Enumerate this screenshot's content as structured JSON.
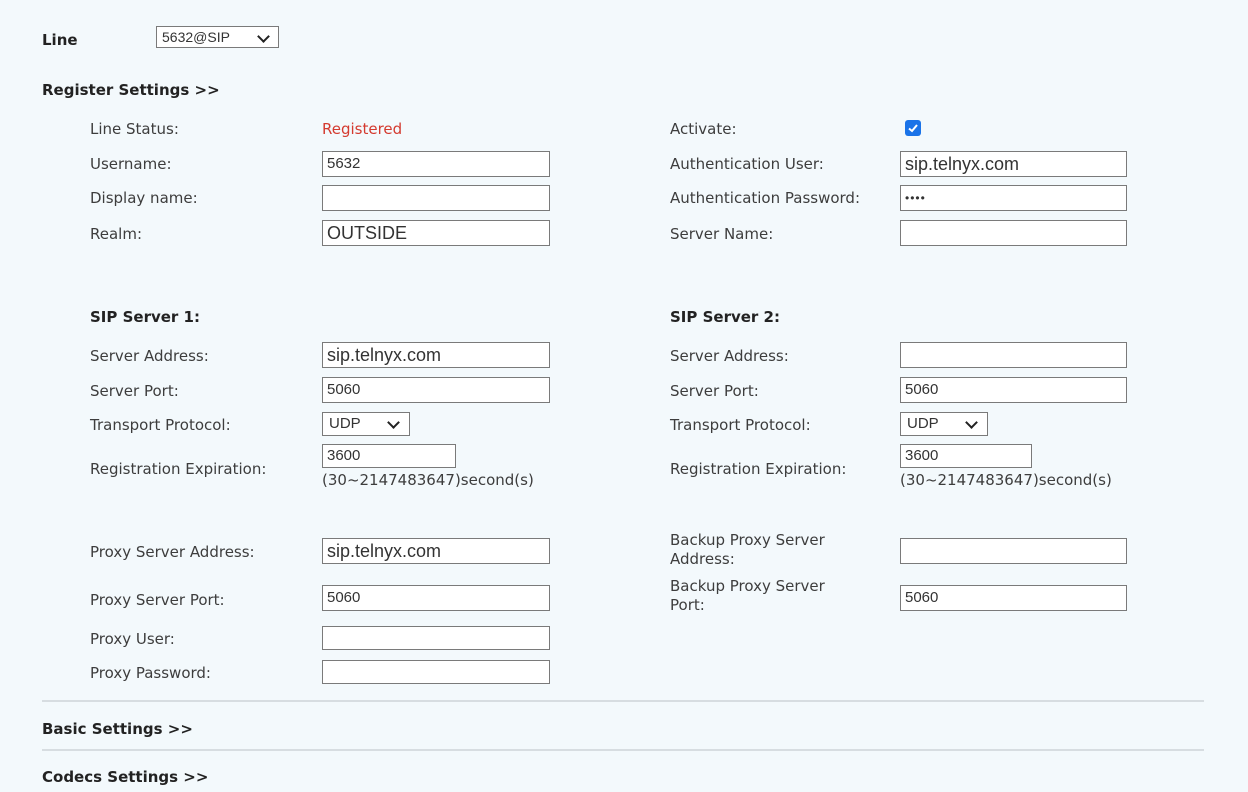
{
  "line": {
    "label": "Line",
    "selected": "5632@SIP"
  },
  "register": {
    "header": "Register Settings >>",
    "line_status": {
      "label": "Line Status:",
      "value": "Registered"
    },
    "activate": {
      "label": "Activate:",
      "checked": true
    },
    "username": {
      "label": "Username:",
      "value": "5632"
    },
    "auth_user": {
      "label": "Authentication User:",
      "value": "sip.telnyx.com"
    },
    "display_name": {
      "label": "Display name:",
      "value": ""
    },
    "auth_password": {
      "label": "Authentication Password:",
      "value": "••••"
    },
    "realm": {
      "label": "Realm:",
      "value": "OUTSIDE"
    },
    "server_name": {
      "label": "Server Name:",
      "value": ""
    }
  },
  "sip1": {
    "header": "SIP Server 1:",
    "address": {
      "label": "Server Address:",
      "value": "sip.telnyx.com"
    },
    "port": {
      "label": "Server Port:",
      "value": "5060"
    },
    "transport": {
      "label": "Transport Protocol:",
      "value": "UDP"
    },
    "expiration": {
      "label": "Registration Expiration:",
      "value": "3600",
      "hint": "(30~2147483647)second(s)"
    }
  },
  "sip2": {
    "header": "SIP Server 2:",
    "address": {
      "label": "Server Address:",
      "value": ""
    },
    "port": {
      "label": "Server Port:",
      "value": "5060"
    },
    "transport": {
      "label": "Transport Protocol:",
      "value": "UDP"
    },
    "expiration": {
      "label": "Registration Expiration:",
      "value": "3600",
      "hint": "(30~2147483647)second(s)"
    }
  },
  "proxy": {
    "address": {
      "label": "Proxy Server Address:",
      "value": "sip.telnyx.com"
    },
    "port": {
      "label": "Proxy Server Port:",
      "value": "5060"
    },
    "user": {
      "label": "Proxy User:",
      "value": ""
    },
    "password": {
      "label": "Proxy Password:",
      "value": ""
    },
    "backup_address": {
      "label_line1": "Backup Proxy Server",
      "label_line2": "Address:",
      "value": ""
    },
    "backup_port": {
      "label_line1": "Backup Proxy Server",
      "label_line2": "Port:",
      "value": "5060"
    }
  },
  "basic": {
    "header": "Basic Settings >>"
  },
  "codecs": {
    "header": "Codecs Settings >>"
  }
}
